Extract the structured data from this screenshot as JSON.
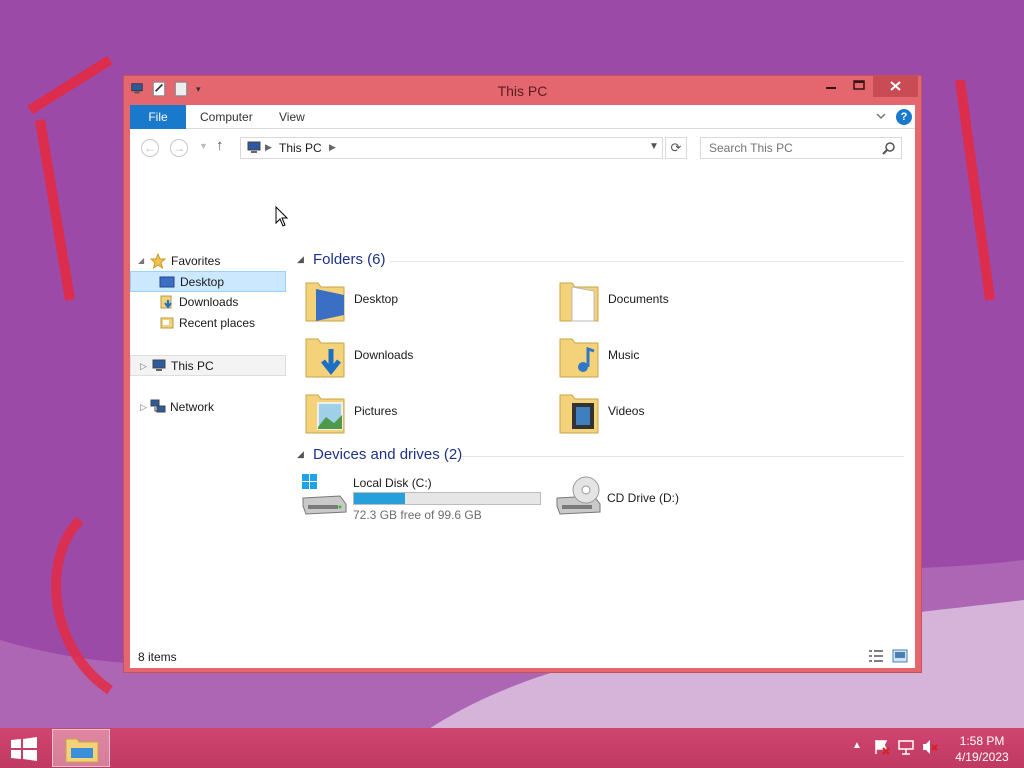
{
  "window": {
    "title": "This PC",
    "controls": {
      "minimize": "–",
      "maximize": "☐",
      "close": "✕"
    }
  },
  "ribbon": {
    "tabs": [
      {
        "label": "File",
        "active": true
      },
      {
        "label": "Computer",
        "active": false
      },
      {
        "label": "View",
        "active": false
      }
    ],
    "help": "?"
  },
  "navigation": {
    "address_crumb": "This PC",
    "search_placeholder": "Search This PC"
  },
  "nav_pane": {
    "favorites": "Favorites",
    "favorites_items": [
      {
        "label": "Desktop",
        "selected": true
      },
      {
        "label": "Downloads"
      },
      {
        "label": "Recent places"
      }
    ],
    "this_pc": "This PC",
    "network": "Network"
  },
  "content": {
    "folders_group": "Folders (6)",
    "folders": [
      "Desktop",
      "Documents",
      "Downloads",
      "Music",
      "Pictures",
      "Videos"
    ],
    "devices_group": "Devices and drives (2)",
    "drives": [
      {
        "label": "Local Disk (C:)",
        "free_text": "72.3 GB free of 99.6 GB",
        "used_fraction": 0.274
      },
      {
        "label": "CD Drive (D:)"
      }
    ]
  },
  "status_bar": {
    "item_count": "8 items"
  },
  "taskbar": {
    "clock_time": "1:58 PM",
    "clock_date": "4/19/2023"
  },
  "colors": {
    "window_frame": "#e4666f",
    "accent": "#1979ca",
    "taskbar": "#cf4570",
    "desktop": "#9c4aa8"
  }
}
